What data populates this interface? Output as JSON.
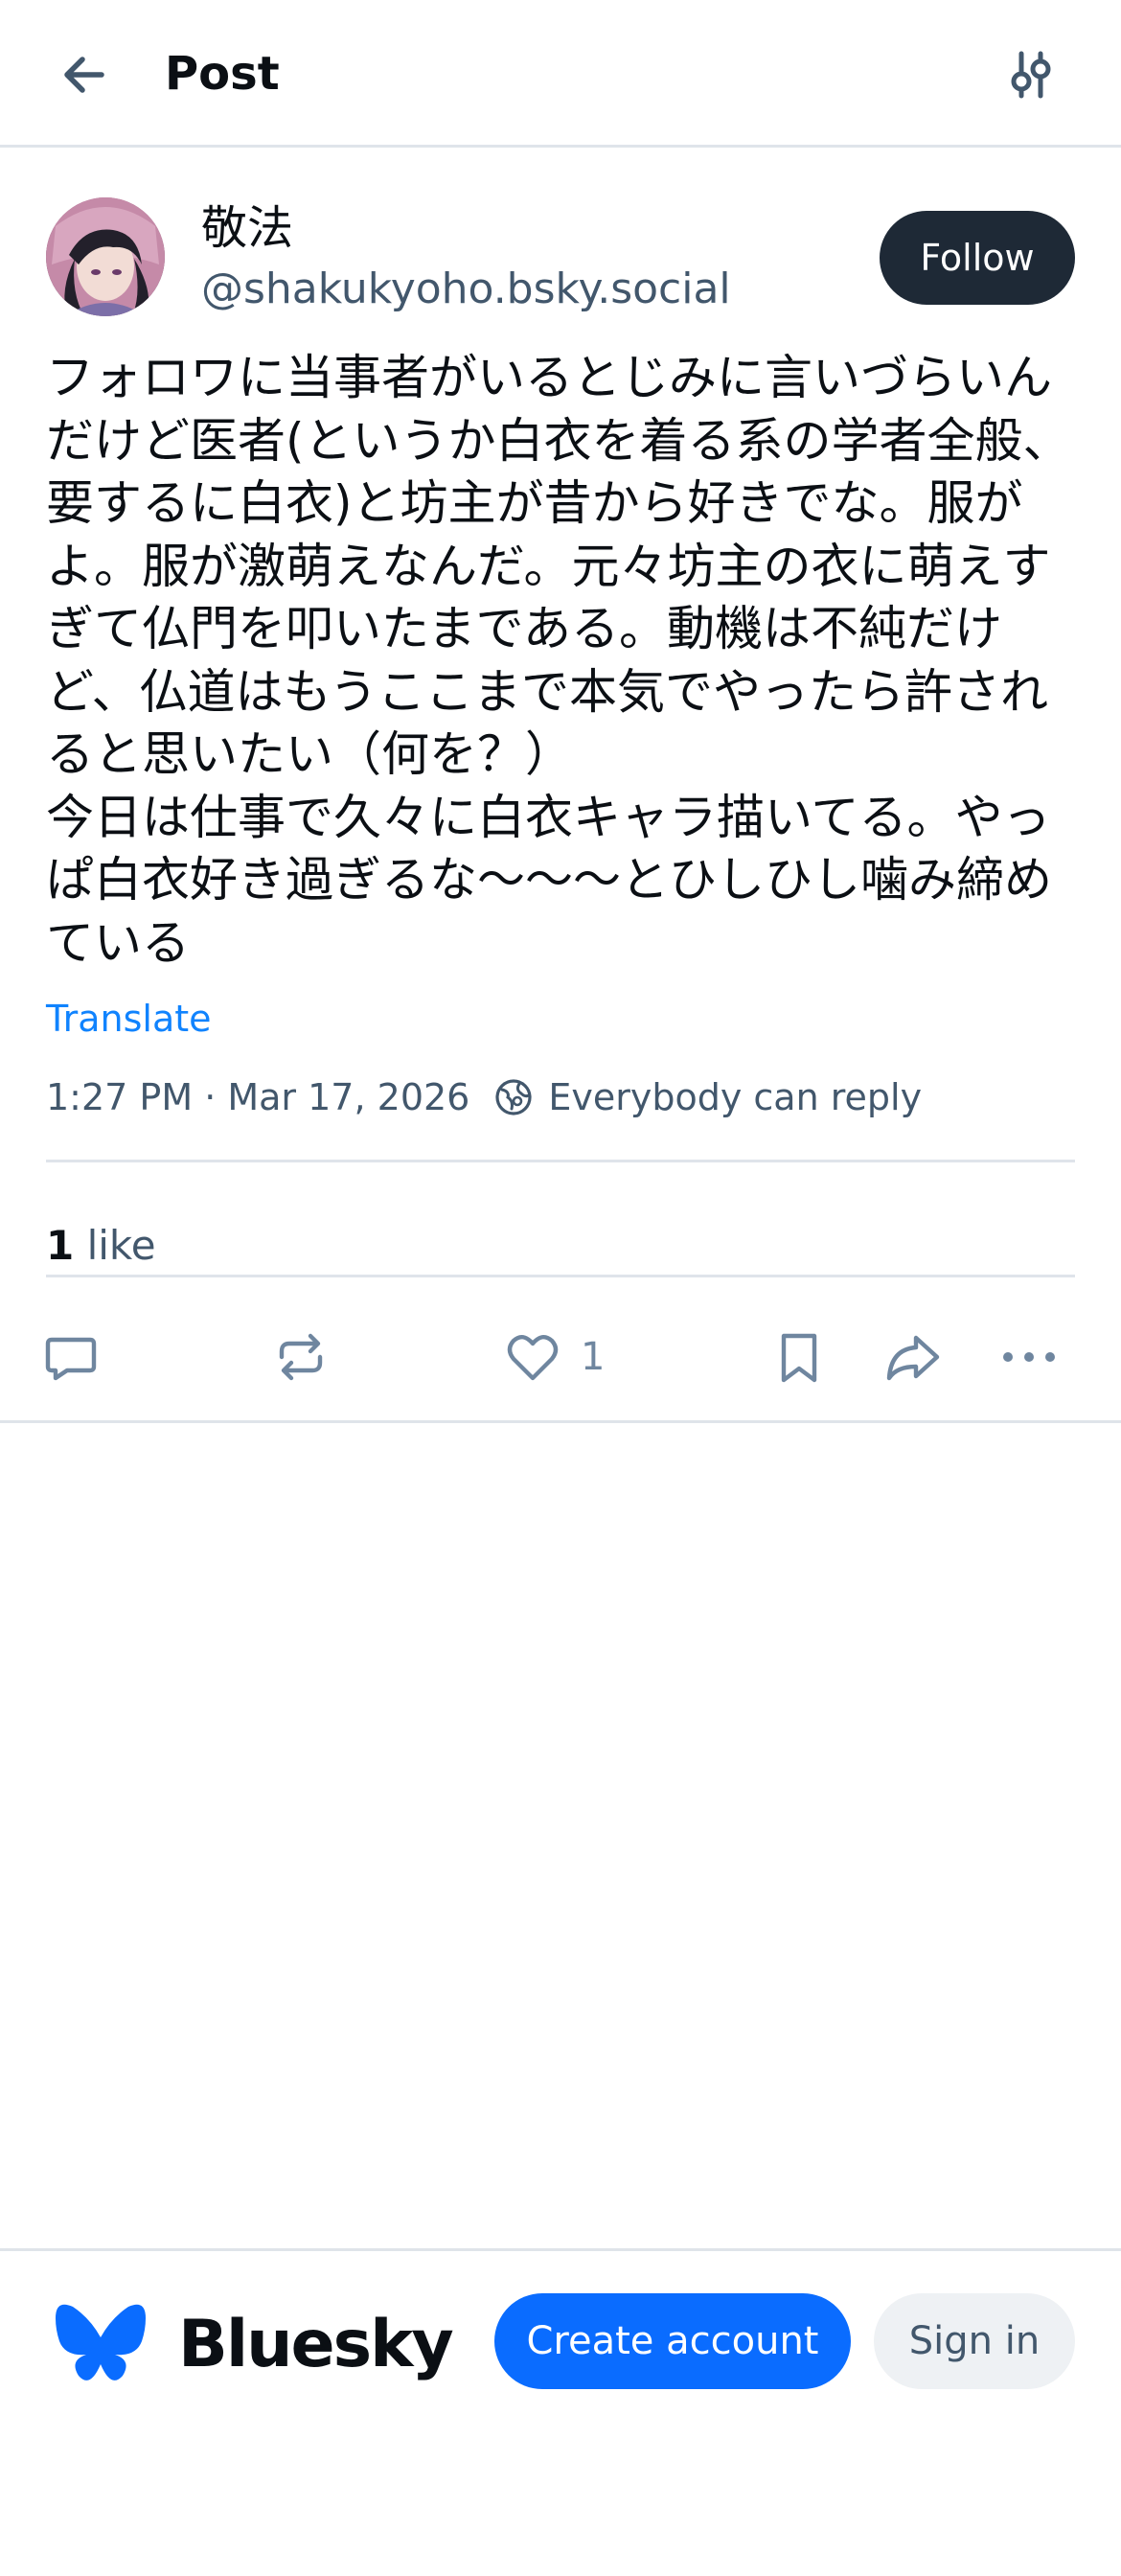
{
  "header": {
    "title": "Post"
  },
  "author": {
    "display_name": "敬法",
    "handle": "@shakukyoho.bsky.social",
    "follow_label": "Follow"
  },
  "post": {
    "text": "フォロワに当事者がいるとじみに言いづらいんだけど医者(というか白衣を着る系の学者全般、要するに白衣)と坊主が昔から好きでな。服がよ。服が激萌えなんだ。元々坊主の衣に萌えすぎて仏門を叩いたまである。動機は不純だけど、仏道はもうここまで本気でやったら許されると思いたい（何を？）\n今日は仕事で久々に白衣キャラ描いてる。やっぱ白衣好き過ぎるな〜〜〜とひしひし噛み締めている",
    "translate_label": "Translate",
    "timestamp": "1:27 PM · Mar 17, 2026",
    "reply_setting": "Everybody can reply",
    "likes_count": "1",
    "likes_label": "like",
    "like_button_count": "1"
  },
  "footer": {
    "brand": "Bluesky",
    "create_account_label": "Create account",
    "sign_in_label": "Sign in"
  },
  "colors": {
    "accent": "#0a6cff",
    "link": "#1083fe",
    "follow_bg": "#1e2936",
    "muted_text": "#42576c"
  }
}
